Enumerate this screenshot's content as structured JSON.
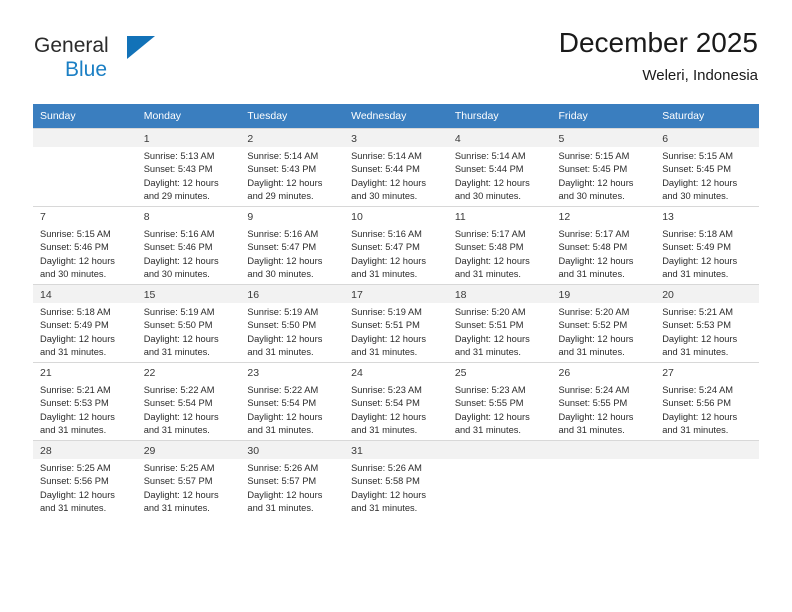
{
  "brand": {
    "name_part1": "General",
    "name_part2": "Blue",
    "triangle_icon": "triangle-icon",
    "accent_color": "#1272b8",
    "blue_text_color": "#1b7fc4"
  },
  "header": {
    "title": "December 2025",
    "subtitle": "Weleri, Indonesia"
  },
  "calendar": {
    "header_bg_color": "#3a7ebf",
    "header_text_color": "#ffffff",
    "shaded_row_color": "#f2f2f2",
    "weekdays": [
      "Sunday",
      "Monday",
      "Tuesday",
      "Wednesday",
      "Thursday",
      "Friday",
      "Saturday"
    ],
    "weeks": [
      {
        "shaded": true,
        "days": [
          {
            "day": "",
            "sunrise": "",
            "sunset": "",
            "daylight_line1": "",
            "daylight_line2": ""
          },
          {
            "day": "1",
            "sunrise": "Sunrise: 5:13 AM",
            "sunset": "Sunset: 5:43 PM",
            "daylight_line1": "Daylight: 12 hours",
            "daylight_line2": "and 29 minutes."
          },
          {
            "day": "2",
            "sunrise": "Sunrise: 5:14 AM",
            "sunset": "Sunset: 5:43 PM",
            "daylight_line1": "Daylight: 12 hours",
            "daylight_line2": "and 29 minutes."
          },
          {
            "day": "3",
            "sunrise": "Sunrise: 5:14 AM",
            "sunset": "Sunset: 5:44 PM",
            "daylight_line1": "Daylight: 12 hours",
            "daylight_line2": "and 30 minutes."
          },
          {
            "day": "4",
            "sunrise": "Sunrise: 5:14 AM",
            "sunset": "Sunset: 5:44 PM",
            "daylight_line1": "Daylight: 12 hours",
            "daylight_line2": "and 30 minutes."
          },
          {
            "day": "5",
            "sunrise": "Sunrise: 5:15 AM",
            "sunset": "Sunset: 5:45 PM",
            "daylight_line1": "Daylight: 12 hours",
            "daylight_line2": "and 30 minutes."
          },
          {
            "day": "6",
            "sunrise": "Sunrise: 5:15 AM",
            "sunset": "Sunset: 5:45 PM",
            "daylight_line1": "Daylight: 12 hours",
            "daylight_line2": "and 30 minutes."
          }
        ]
      },
      {
        "shaded": false,
        "days": [
          {
            "day": "7",
            "sunrise": "Sunrise: 5:15 AM",
            "sunset": "Sunset: 5:46 PM",
            "daylight_line1": "Daylight: 12 hours",
            "daylight_line2": "and 30 minutes."
          },
          {
            "day": "8",
            "sunrise": "Sunrise: 5:16 AM",
            "sunset": "Sunset: 5:46 PM",
            "daylight_line1": "Daylight: 12 hours",
            "daylight_line2": "and 30 minutes."
          },
          {
            "day": "9",
            "sunrise": "Sunrise: 5:16 AM",
            "sunset": "Sunset: 5:47 PM",
            "daylight_line1": "Daylight: 12 hours",
            "daylight_line2": "and 30 minutes."
          },
          {
            "day": "10",
            "sunrise": "Sunrise: 5:16 AM",
            "sunset": "Sunset: 5:47 PM",
            "daylight_line1": "Daylight: 12 hours",
            "daylight_line2": "and 31 minutes."
          },
          {
            "day": "11",
            "sunrise": "Sunrise: 5:17 AM",
            "sunset": "Sunset: 5:48 PM",
            "daylight_line1": "Daylight: 12 hours",
            "daylight_line2": "and 31 minutes."
          },
          {
            "day": "12",
            "sunrise": "Sunrise: 5:17 AM",
            "sunset": "Sunset: 5:48 PM",
            "daylight_line1": "Daylight: 12 hours",
            "daylight_line2": "and 31 minutes."
          },
          {
            "day": "13",
            "sunrise": "Sunrise: 5:18 AM",
            "sunset": "Sunset: 5:49 PM",
            "daylight_line1": "Daylight: 12 hours",
            "daylight_line2": "and 31 minutes."
          }
        ]
      },
      {
        "shaded": true,
        "days": [
          {
            "day": "14",
            "sunrise": "Sunrise: 5:18 AM",
            "sunset": "Sunset: 5:49 PM",
            "daylight_line1": "Daylight: 12 hours",
            "daylight_line2": "and 31 minutes."
          },
          {
            "day": "15",
            "sunrise": "Sunrise: 5:19 AM",
            "sunset": "Sunset: 5:50 PM",
            "daylight_line1": "Daylight: 12 hours",
            "daylight_line2": "and 31 minutes."
          },
          {
            "day": "16",
            "sunrise": "Sunrise: 5:19 AM",
            "sunset": "Sunset: 5:50 PM",
            "daylight_line1": "Daylight: 12 hours",
            "daylight_line2": "and 31 minutes."
          },
          {
            "day": "17",
            "sunrise": "Sunrise: 5:19 AM",
            "sunset": "Sunset: 5:51 PM",
            "daylight_line1": "Daylight: 12 hours",
            "daylight_line2": "and 31 minutes."
          },
          {
            "day": "18",
            "sunrise": "Sunrise: 5:20 AM",
            "sunset": "Sunset: 5:51 PM",
            "daylight_line1": "Daylight: 12 hours",
            "daylight_line2": "and 31 minutes."
          },
          {
            "day": "19",
            "sunrise": "Sunrise: 5:20 AM",
            "sunset": "Sunset: 5:52 PM",
            "daylight_line1": "Daylight: 12 hours",
            "daylight_line2": "and 31 minutes."
          },
          {
            "day": "20",
            "sunrise": "Sunrise: 5:21 AM",
            "sunset": "Sunset: 5:53 PM",
            "daylight_line1": "Daylight: 12 hours",
            "daylight_line2": "and 31 minutes."
          }
        ]
      },
      {
        "shaded": false,
        "days": [
          {
            "day": "21",
            "sunrise": "Sunrise: 5:21 AM",
            "sunset": "Sunset: 5:53 PM",
            "daylight_line1": "Daylight: 12 hours",
            "daylight_line2": "and 31 minutes."
          },
          {
            "day": "22",
            "sunrise": "Sunrise: 5:22 AM",
            "sunset": "Sunset: 5:54 PM",
            "daylight_line1": "Daylight: 12 hours",
            "daylight_line2": "and 31 minutes."
          },
          {
            "day": "23",
            "sunrise": "Sunrise: 5:22 AM",
            "sunset": "Sunset: 5:54 PM",
            "daylight_line1": "Daylight: 12 hours",
            "daylight_line2": "and 31 minutes."
          },
          {
            "day": "24",
            "sunrise": "Sunrise: 5:23 AM",
            "sunset": "Sunset: 5:54 PM",
            "daylight_line1": "Daylight: 12 hours",
            "daylight_line2": "and 31 minutes."
          },
          {
            "day": "25",
            "sunrise": "Sunrise: 5:23 AM",
            "sunset": "Sunset: 5:55 PM",
            "daylight_line1": "Daylight: 12 hours",
            "daylight_line2": "and 31 minutes."
          },
          {
            "day": "26",
            "sunrise": "Sunrise: 5:24 AM",
            "sunset": "Sunset: 5:55 PM",
            "daylight_line1": "Daylight: 12 hours",
            "daylight_line2": "and 31 minutes."
          },
          {
            "day": "27",
            "sunrise": "Sunrise: 5:24 AM",
            "sunset": "Sunset: 5:56 PM",
            "daylight_line1": "Daylight: 12 hours",
            "daylight_line2": "and 31 minutes."
          }
        ]
      },
      {
        "shaded": true,
        "days": [
          {
            "day": "28",
            "sunrise": "Sunrise: 5:25 AM",
            "sunset": "Sunset: 5:56 PM",
            "daylight_line1": "Daylight: 12 hours",
            "daylight_line2": "and 31 minutes."
          },
          {
            "day": "29",
            "sunrise": "Sunrise: 5:25 AM",
            "sunset": "Sunset: 5:57 PM",
            "daylight_line1": "Daylight: 12 hours",
            "daylight_line2": "and 31 minutes."
          },
          {
            "day": "30",
            "sunrise": "Sunrise: 5:26 AM",
            "sunset": "Sunset: 5:57 PM",
            "daylight_line1": "Daylight: 12 hours",
            "daylight_line2": "and 31 minutes."
          },
          {
            "day": "31",
            "sunrise": "Sunrise: 5:26 AM",
            "sunset": "Sunset: 5:58 PM",
            "daylight_line1": "Daylight: 12 hours",
            "daylight_line2": "and 31 minutes."
          },
          {
            "day": "",
            "sunrise": "",
            "sunset": "",
            "daylight_line1": "",
            "daylight_line2": ""
          },
          {
            "day": "",
            "sunrise": "",
            "sunset": "",
            "daylight_line1": "",
            "daylight_line2": ""
          },
          {
            "day": "",
            "sunrise": "",
            "sunset": "",
            "daylight_line1": "",
            "daylight_line2": ""
          }
        ]
      }
    ]
  }
}
